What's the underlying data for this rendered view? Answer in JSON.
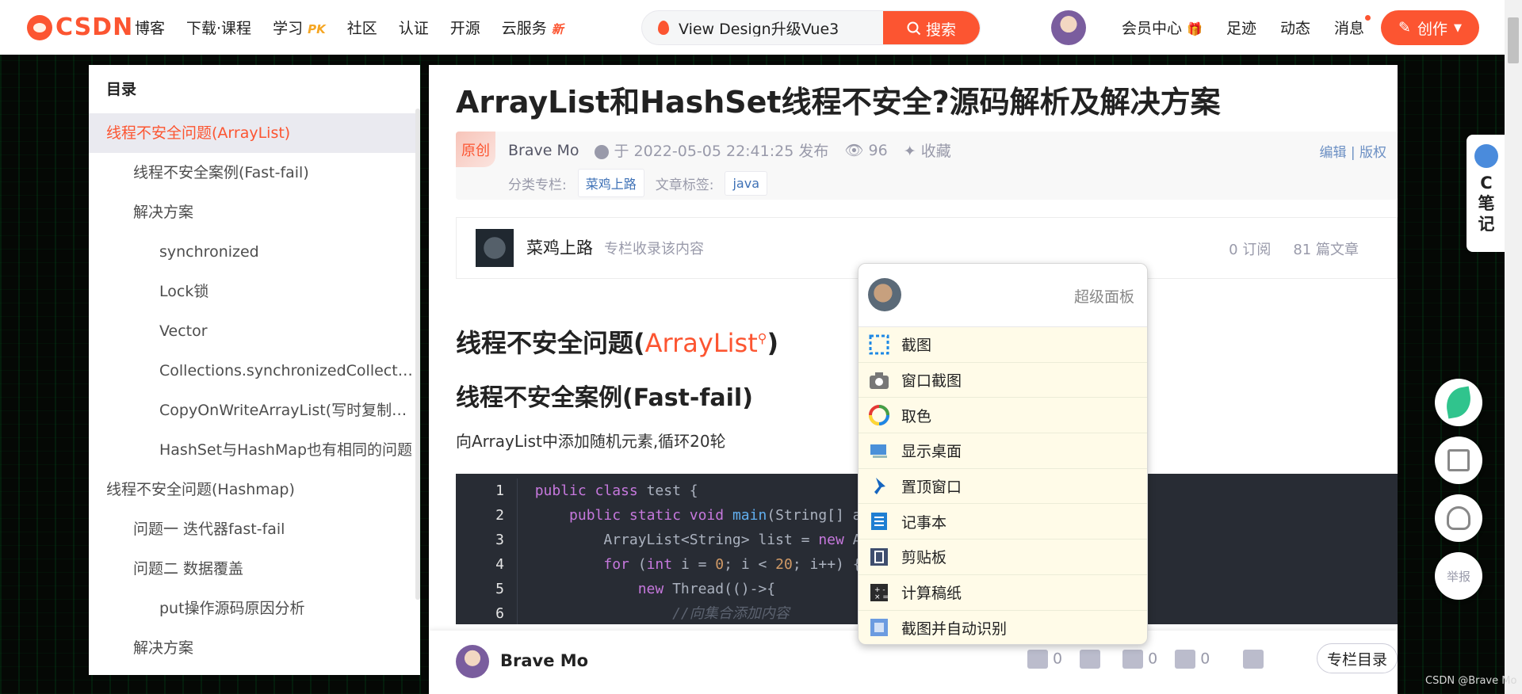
{
  "topbar": {
    "logo": "CSDN",
    "nav": [
      {
        "label": "博客",
        "tag": ""
      },
      {
        "label": "下载·课程",
        "tag": ""
      },
      {
        "label": "学习",
        "tag": "PK"
      },
      {
        "label": "社区",
        "tag": ""
      },
      {
        "label": "认证",
        "tag": ""
      },
      {
        "label": "开源",
        "tag": ""
      },
      {
        "label": "云服务",
        "tag": "新"
      }
    ],
    "search_value": "View Design升级Vue3",
    "search_button": "搜索",
    "right_nav": [
      "会员中心",
      "足迹",
      "动态",
      "消息"
    ],
    "create_button": "创作"
  },
  "toc": {
    "title": "目录",
    "items": [
      {
        "label": "线程不安全问题(ArrayList)",
        "level": 1,
        "active": true
      },
      {
        "label": "线程不安全案例(Fast-fail)",
        "level": 2
      },
      {
        "label": "解决方案",
        "level": 2
      },
      {
        "label": "synchronized",
        "level": 3
      },
      {
        "label": "Lock锁",
        "level": 3
      },
      {
        "label": "Vector",
        "level": 3
      },
      {
        "label": "Collections.synchronizedCollection",
        "level": 3
      },
      {
        "label": "CopyOnWriteArrayList(写时复制技术)",
        "level": 3
      },
      {
        "label": "HashSet与HashMap也有相同的问题",
        "level": 3
      },
      {
        "label": "线程不安全问题(Hashmap)",
        "level": 1
      },
      {
        "label": "问题一 迭代器fast-fail",
        "level": 2
      },
      {
        "label": "问题二 数据覆盖",
        "level": 2
      },
      {
        "label": "put操作源码原因分析",
        "level": 3
      },
      {
        "label": "解决方案",
        "level": 2
      }
    ]
  },
  "article": {
    "title": "ArrayList和HashSet线程不安全?源码解析及解决方案",
    "original_badge": "原创",
    "author": "Brave Mo",
    "published": "于 2022-05-05 22:41:25 发布",
    "views": "96",
    "collect": "收藏",
    "edit": "编辑",
    "sep": "|",
    "copyright": "版权",
    "category_label": "分类专栏:",
    "category": "菜鸡上路",
    "tag_label": "文章标签:",
    "tag": "java",
    "column": {
      "name": "菜鸡上路",
      "desc": "专栏收录该内容",
      "subs": "0 订阅",
      "articles": "81 篇文章"
    },
    "h1_prefix": "线程不安全问题(",
    "h1_link": "ArrayList",
    "h1_suffix": ")",
    "h2": "线程不安全案例(Fast-fail)",
    "para": "向ArrayList中添加随机元素,循环20轮",
    "code_lines": [
      "1",
      "2",
      "3",
      "4",
      "5",
      "6"
    ]
  },
  "bottom_bar": {
    "author": "Brave Mo",
    "likes": "0",
    "comments": "0",
    "stars": "0",
    "catalog_button": "专栏目录"
  },
  "panel": {
    "title": "超级面板",
    "items": [
      {
        "label": "截图",
        "icon": "screenshot-icon",
        "color": "#1e88e5"
      },
      {
        "label": "窗口截图",
        "icon": "camera-icon",
        "color": "#777777"
      },
      {
        "label": "取色",
        "icon": "color-wheel-icon",
        "color": "#e53935"
      },
      {
        "label": "显示桌面",
        "icon": "desktop-icon",
        "color": "#4a90d9"
      },
      {
        "label": "置顶窗口",
        "icon": "pin-icon",
        "color": "#1565c0"
      },
      {
        "label": "记事本",
        "icon": "notepad-icon",
        "color": "#1e7fd2"
      },
      {
        "label": "剪贴板",
        "icon": "clipboard-icon",
        "color": "#3f4e6e"
      },
      {
        "label": "计算稿纸",
        "icon": "calculator-icon",
        "color": "#2b2b2b"
      },
      {
        "label": "截图并自动识别",
        "icon": "ocr-icon",
        "color": "#6b9be0"
      }
    ]
  },
  "side": {
    "cnote": [
      "C",
      "笔",
      "记"
    ],
    "report": "举报"
  },
  "watermark": "CSDN @Brave Mo"
}
